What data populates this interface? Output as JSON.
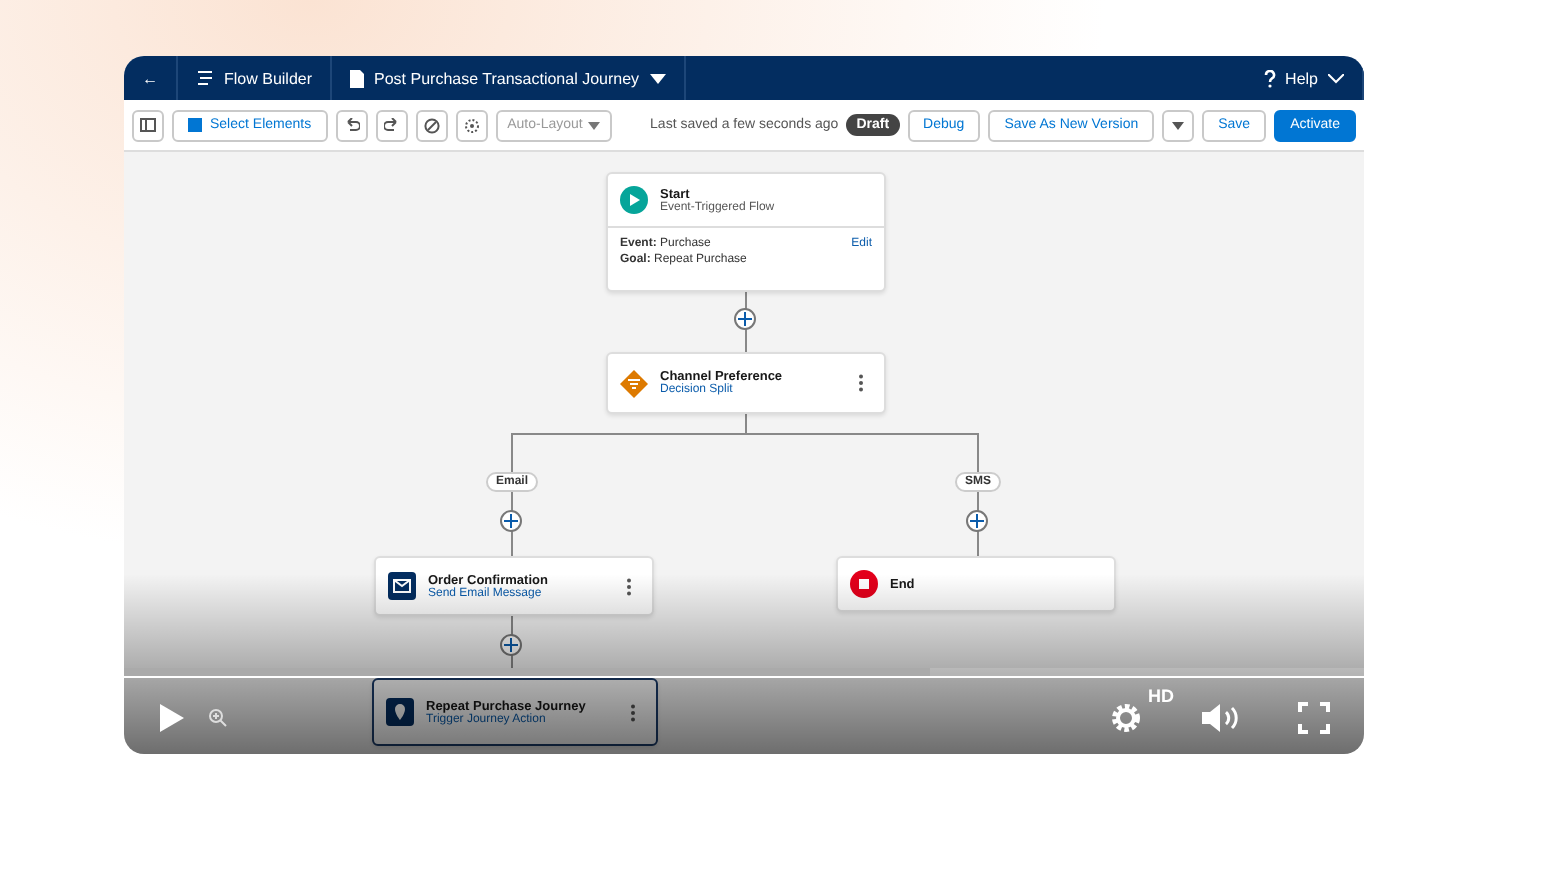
{
  "header": {
    "back": "←",
    "app": "Flow Builder",
    "flow_name": "Post Purchase Transactional Journey",
    "help": "Help"
  },
  "toolbar": {
    "select_elements": "Select Elements",
    "layout": "Auto-Layout",
    "saved_note": "Last saved a few seconds ago",
    "status_badge": "Draft",
    "buttons": [
      {
        "label": "Debug",
        "kind": "neutral"
      },
      {
        "label": "Save As New Version",
        "kind": "split"
      },
      {
        "label": "Save",
        "kind": "neutral"
      },
      {
        "label": "Activate",
        "kind": "brand"
      }
    ]
  },
  "canvas": {
    "start": {
      "title": "Start",
      "subtitle": "Event-Triggered Flow",
      "edit": "Edit",
      "fields": [
        {
          "label": "Event:",
          "value": "Purchase"
        },
        {
          "label": "Goal:",
          "value": "Repeat Purchase"
        }
      ]
    },
    "nodes": [
      {
        "kind": "decision",
        "title": "Channel Preference",
        "subtitle": "Decision Split"
      },
      {
        "kind": "email",
        "title": "Order Confirmation",
        "subtitle": "Send Email Message"
      },
      {
        "kind": "end",
        "title": "End"
      },
      {
        "kind": "journey",
        "title": "Repeat Purchase Journey",
        "subtitle": "Trigger Journey Action",
        "selected": true
      }
    ],
    "branches": [
      {
        "label": "Email"
      },
      {
        "label": "SMS"
      }
    ]
  },
  "player": {
    "level": 0.65,
    "quality": "HD"
  }
}
